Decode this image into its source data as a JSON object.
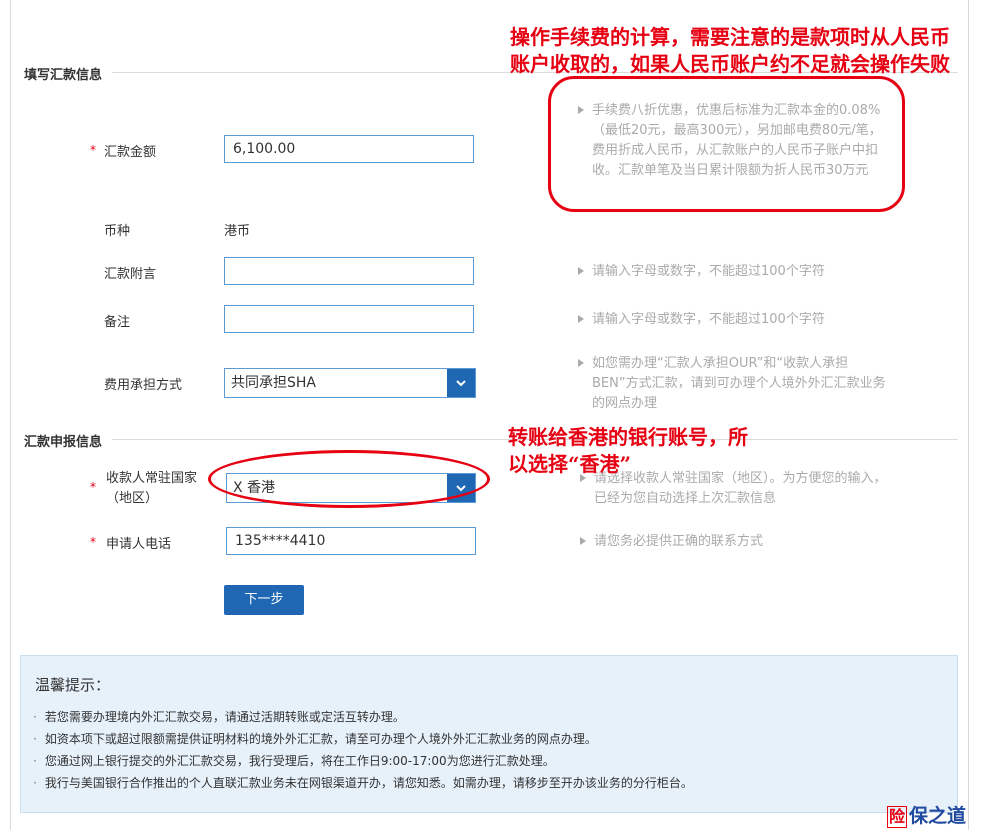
{
  "section1": {
    "title": "填写汇款信息"
  },
  "amount": {
    "label": "汇款金额",
    "required": "*",
    "value": "6,100.00"
  },
  "fee_hint": {
    "text": "手续费八折优惠，优惠后标准为汇款本金的0.08%（最低20元，最高300元），另加邮电费80元/笔，费用折成人民币，从汇款账户的人民币子账户中扣收。汇款单笔及当日累计限额为折人民币30万元"
  },
  "currency": {
    "label": "币种",
    "value": "港币"
  },
  "remit_note": {
    "label": "汇款附言",
    "value": "",
    "hint": "请输入字母或数字，不能超过100个字符"
  },
  "remark": {
    "label": "备注",
    "value": "",
    "hint": "请输入字母或数字，不能超过100个字符"
  },
  "fee_mode": {
    "label": "费用承担方式",
    "selected": "共同承担SHA",
    "hint": "如您需办理“汇款人承担OUR”和“收款人承担BEN”方式汇款，请到可办理个人境外外汇汇款业务的网点办理"
  },
  "section2": {
    "title": "汇款申报信息"
  },
  "country": {
    "label": "收款人常驻国家（地区）",
    "required": "*",
    "selected": "X 香港",
    "hint": "请选择收款人常驻国家（地区）。为方便您的输入，已经为您自动选择上次汇款信息"
  },
  "phone": {
    "label": "申请人电话",
    "required": "*",
    "value": "135****4410",
    "hint": "请您务必提供正确的联系方式"
  },
  "next_button": {
    "label": "下一步"
  },
  "tips": {
    "title": "温馨提示：",
    "items": [
      "若您需要办理境内外汇汇款交易，请通过活期转账或定活互转办理。",
      "如资本项下或超过限额需提供证明材料的境外外汇汇款，请至可办理个人境外外汇汇款业务的网点办理。",
      "您通过网上银行提交的外汇汇款交易，我行受理后，将在工作日9:00-17:00为您进行汇款处理。",
      "我行与美国银行合作推出的个人直联汇款业务未在网银渠道开办，请您知悉。如需办理，请移步至开办该业务的分行柜台。"
    ]
  },
  "annotations": {
    "fee_note": "操作手续费的计算，需要注意的是款项时从人民币账户收取的，如果人民币账户约不足就会操作失败",
    "country_note": "转账给香港的银行账号，所以选择“香港”"
  },
  "watermark": {
    "box": "险",
    "text": "保之道"
  },
  "colors": {
    "accent": "#1f67b3",
    "annotation": "#e60012",
    "tips_bg": "#e6f1fa"
  }
}
